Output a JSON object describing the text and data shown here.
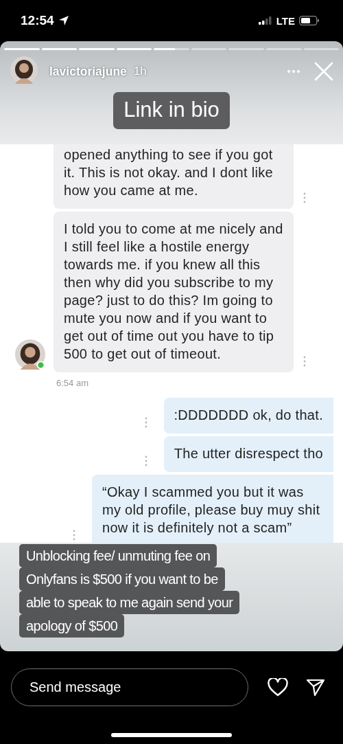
{
  "status_bar": {
    "time": "12:54",
    "network": "LTE"
  },
  "story": {
    "progress": [
      {
        "level": 1
      },
      {
        "level": 1
      },
      {
        "level": 1
      },
      {
        "level": 1
      },
      {
        "level": 0.6
      },
      {
        "level": 0
      },
      {
        "level": 0
      },
      {
        "level": 0
      },
      {
        "level": 0
      }
    ],
    "username": "lavictoriajune",
    "age": "1h",
    "sticker": "Link in bio"
  },
  "chat": {
    "messages": [
      {
        "kind": "received",
        "avatar": false,
        "text": "opened anything to see if you got it. This is not okay. and I dont like how you came at me."
      },
      {
        "kind": "received",
        "avatar": true,
        "text": "I told you to come at me nicely and I still feel like a hostile energy towards me. if you knew all this then why did you subscribe to my page? just to do this? Im going to mute you now and if you want to get out of time out you have to tip 500 to get out of timeout.",
        "time": "6:54 am"
      },
      {
        "kind": "sent",
        "avatar": false,
        "text": ":DDDDDDD ok, do that."
      },
      {
        "kind": "sent",
        "avatar": false,
        "text": "The utter disrespect tho"
      },
      {
        "kind": "sent",
        "avatar": false,
        "text": "“Okay I scammed you but it was my old profile, please buy muy shit now it is definitely not a scam”"
      }
    ]
  },
  "caption": [
    "Unblocking fee/ unmuting fee on",
    "Onlyfans is $500 if you want to be",
    "able to speak to me again send your",
    "apology of $500"
  ],
  "reply": {
    "placeholder": "Send message"
  }
}
